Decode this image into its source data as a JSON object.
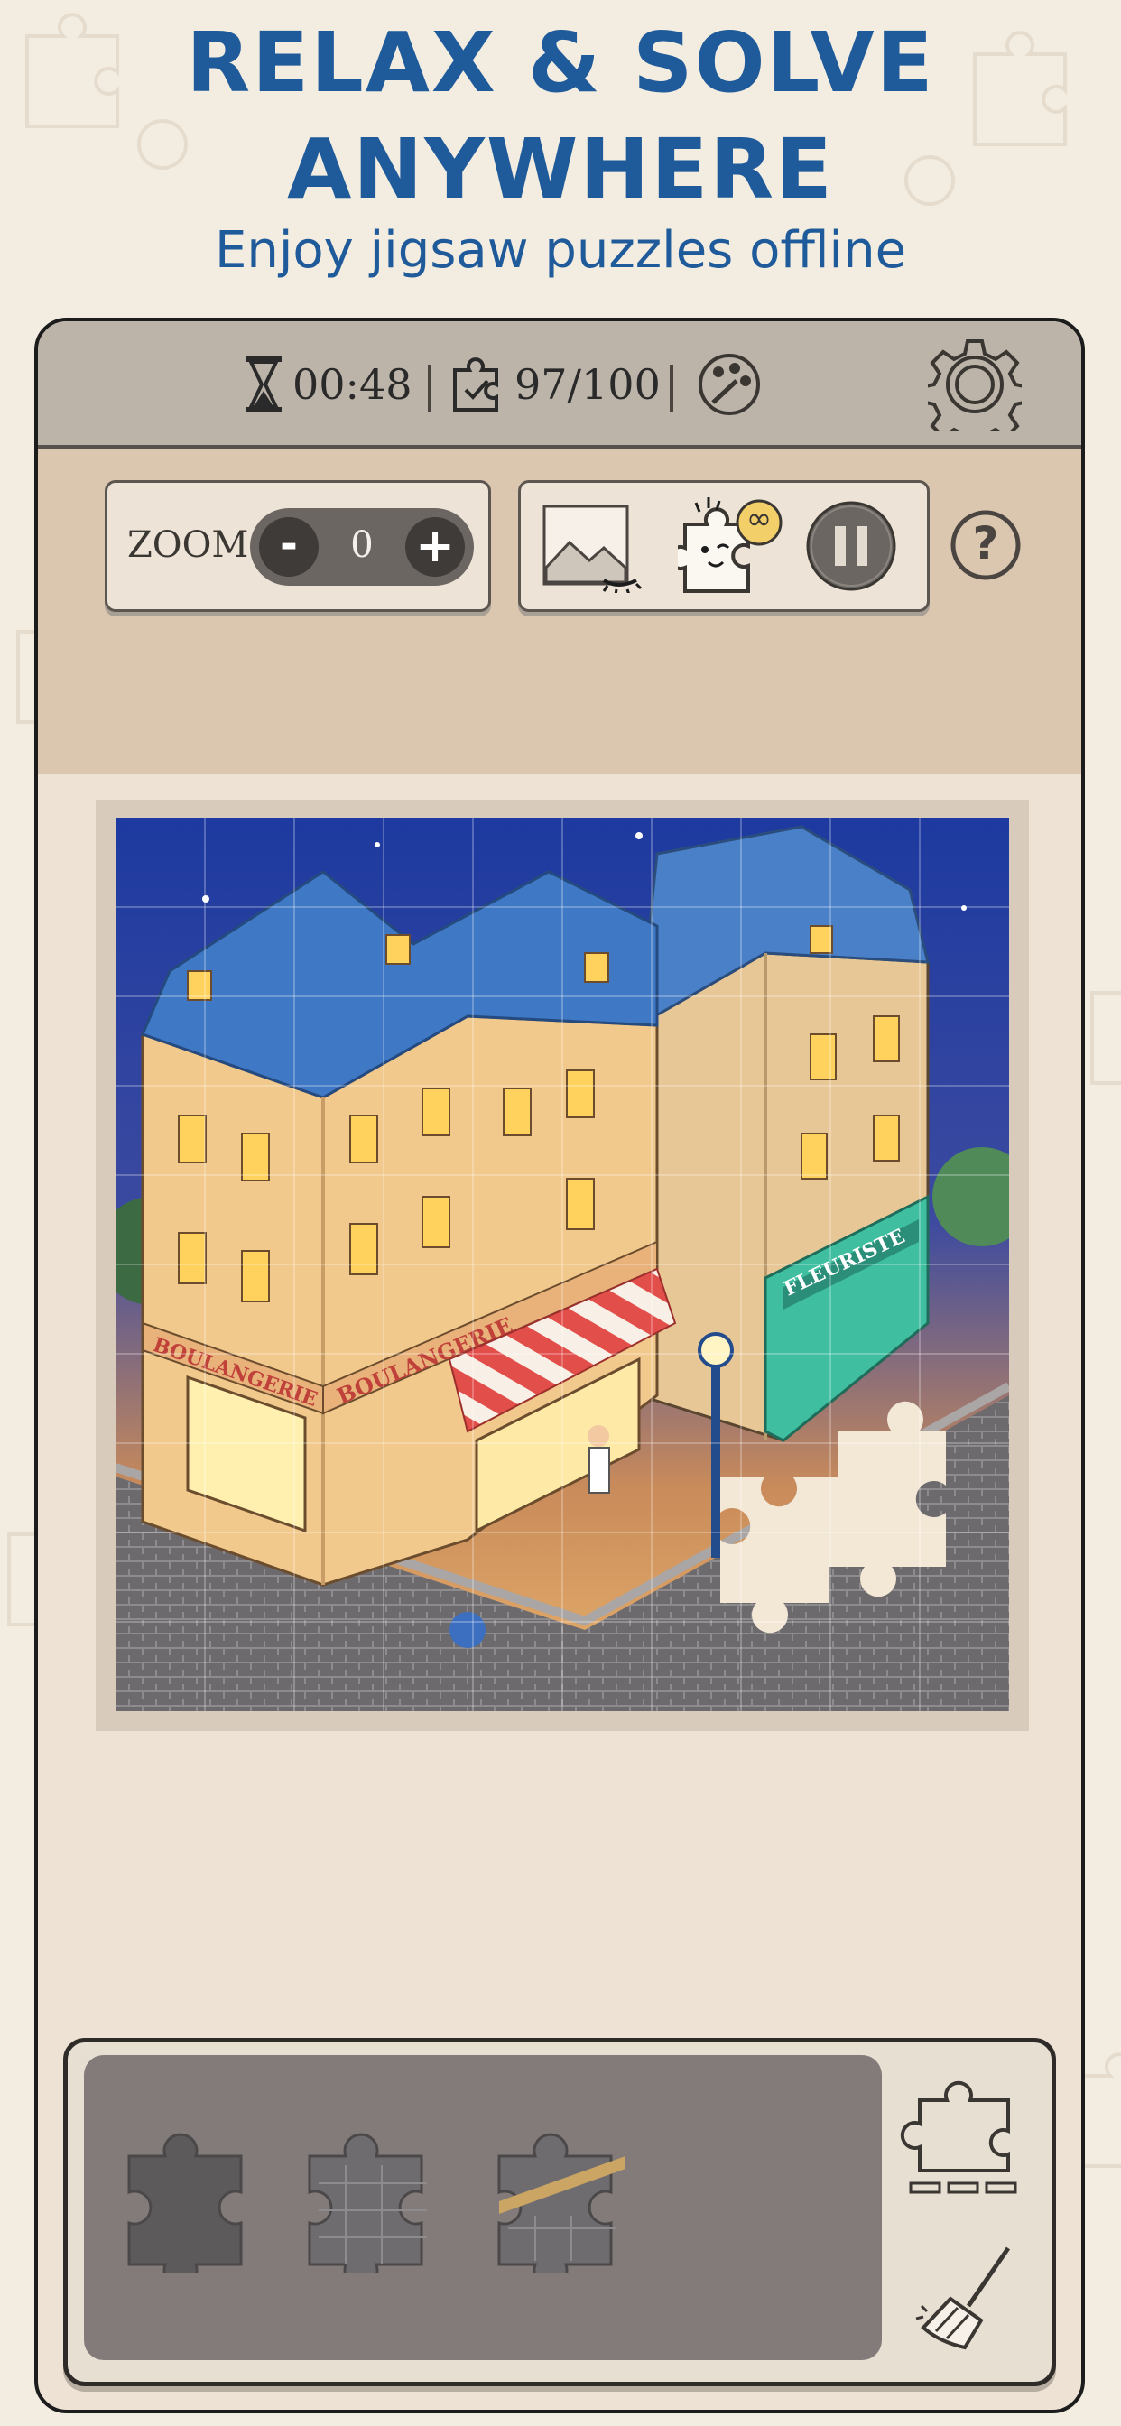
{
  "promo": {
    "title_line1": "RELAX & SOLVE",
    "title_line2": "ANYWHERE",
    "subtitle": "Enjoy jigsaw puzzles offline"
  },
  "status_bar": {
    "timer": "00:48",
    "pieces": "97/100",
    "icons": [
      "hourglass-icon",
      "puzzle-check-icon",
      "palette-icon",
      "settings-gear-icon"
    ]
  },
  "toolbar": {
    "zoom_label": "ZOOM:",
    "zoom_minus": "-",
    "zoom_value": "0",
    "zoom_plus": "+",
    "help": "?",
    "icons": [
      "preview-image-icon",
      "hint-piece-icon",
      "pause-icon",
      "help-icon"
    ],
    "hint_badge": "∞"
  },
  "puzzle": {
    "shop_sign_left": "BOULANGERIE",
    "shop_sign_right": "BOULANGERIE",
    "shop_sign_florist": "FLEURISTE",
    "progress_fraction": 0.97
  },
  "tray": {
    "piece_count": 3,
    "icons": [
      "piece-sort-icon",
      "broom-icon"
    ]
  },
  "colors": {
    "title_blue": "#1f5b9a",
    "topbar": "#bdb4a9",
    "toolbar_band": "#dbc6b0",
    "tray": "#837b79",
    "board": "#ede2d3"
  }
}
